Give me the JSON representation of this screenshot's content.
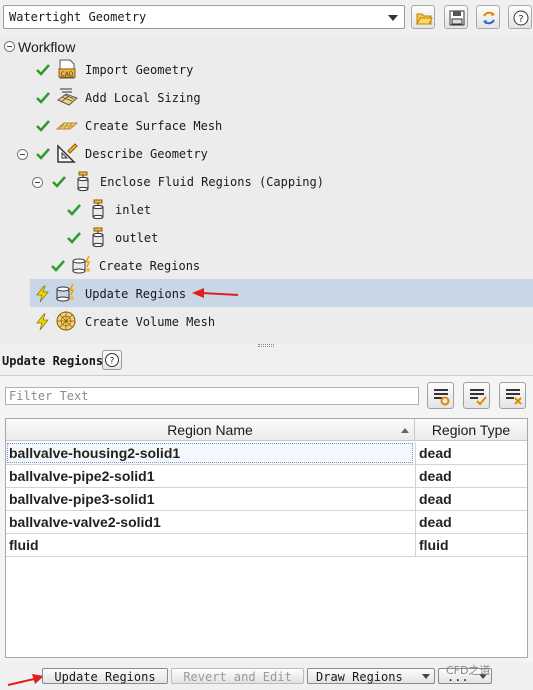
{
  "workflow_selector": {
    "value": "Watertight Geometry"
  },
  "toolbar": {
    "icons": [
      "open-folder-icon",
      "save-icon",
      "refresh-icon",
      "help-icon"
    ]
  },
  "tree": {
    "root_label": "Workflow",
    "items": [
      {
        "label": "Import Geometry",
        "status": "done",
        "icon": "cad-import-icon"
      },
      {
        "label": "Add Local Sizing",
        "status": "done",
        "icon": "local-sizing-icon"
      },
      {
        "label": "Create Surface Mesh",
        "status": "done",
        "icon": "surface-mesh-icon"
      },
      {
        "label": "Describe Geometry",
        "status": "done",
        "icon": "describe-geometry-icon"
      },
      {
        "label": "Enclose Fluid Regions (Capping)",
        "status": "done",
        "icon": "capping-icon"
      },
      {
        "label": "inlet",
        "status": "done",
        "icon": "cap-icon"
      },
      {
        "label": "outlet",
        "status": "done",
        "icon": "cap-icon"
      },
      {
        "label": "Create Regions",
        "status": "done",
        "icon": "create-regions-icon"
      },
      {
        "label": "Update Regions",
        "status": "pending",
        "icon": "update-regions-icon",
        "selected": true
      },
      {
        "label": "Create Volume Mesh",
        "status": "pending",
        "icon": "volume-mesh-icon"
      }
    ]
  },
  "task": {
    "title": "Update Regions",
    "filter_placeholder": "Filter Text",
    "table": {
      "columns": [
        "Region Name",
        "Region Type"
      ],
      "rows": [
        [
          "ballvalve-housing2-solid1",
          "dead"
        ],
        [
          "ballvalve-pipe2-solid1",
          "dead"
        ],
        [
          "ballvalve-pipe3-solid1",
          "dead"
        ],
        [
          "ballvalve-valve2-solid1",
          "dead"
        ],
        [
          "fluid",
          "fluid"
        ]
      ]
    }
  },
  "buttons": {
    "update": "Update Regions",
    "revert": "Revert and Edit",
    "draw": "Draw Regions",
    "more": "..."
  },
  "watermark": "CFD之道",
  "colors": {
    "check_green": "#2e9b2e",
    "selected_row": "#c9d6e6",
    "pending_yellow": "#f5d800",
    "arrow_red": "#e02020"
  }
}
